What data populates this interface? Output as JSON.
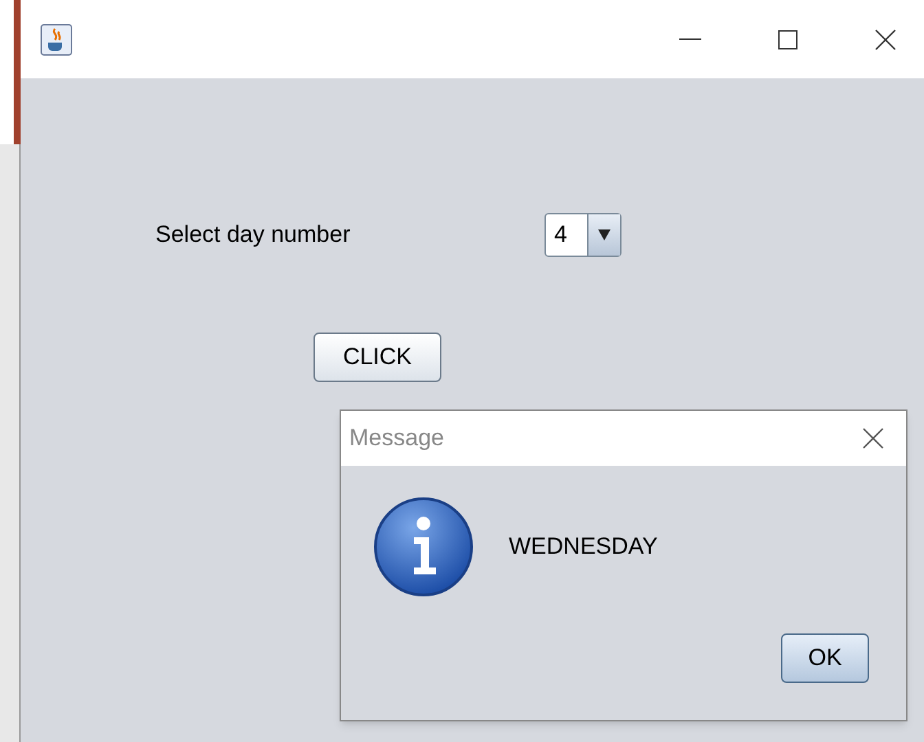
{
  "form": {
    "label": "Select day number",
    "day_select": {
      "value": "4"
    },
    "button": "CLICK"
  },
  "dialog": {
    "title": "Message",
    "kind": "info",
    "message": "WEDNESDAY",
    "button": "OK"
  }
}
